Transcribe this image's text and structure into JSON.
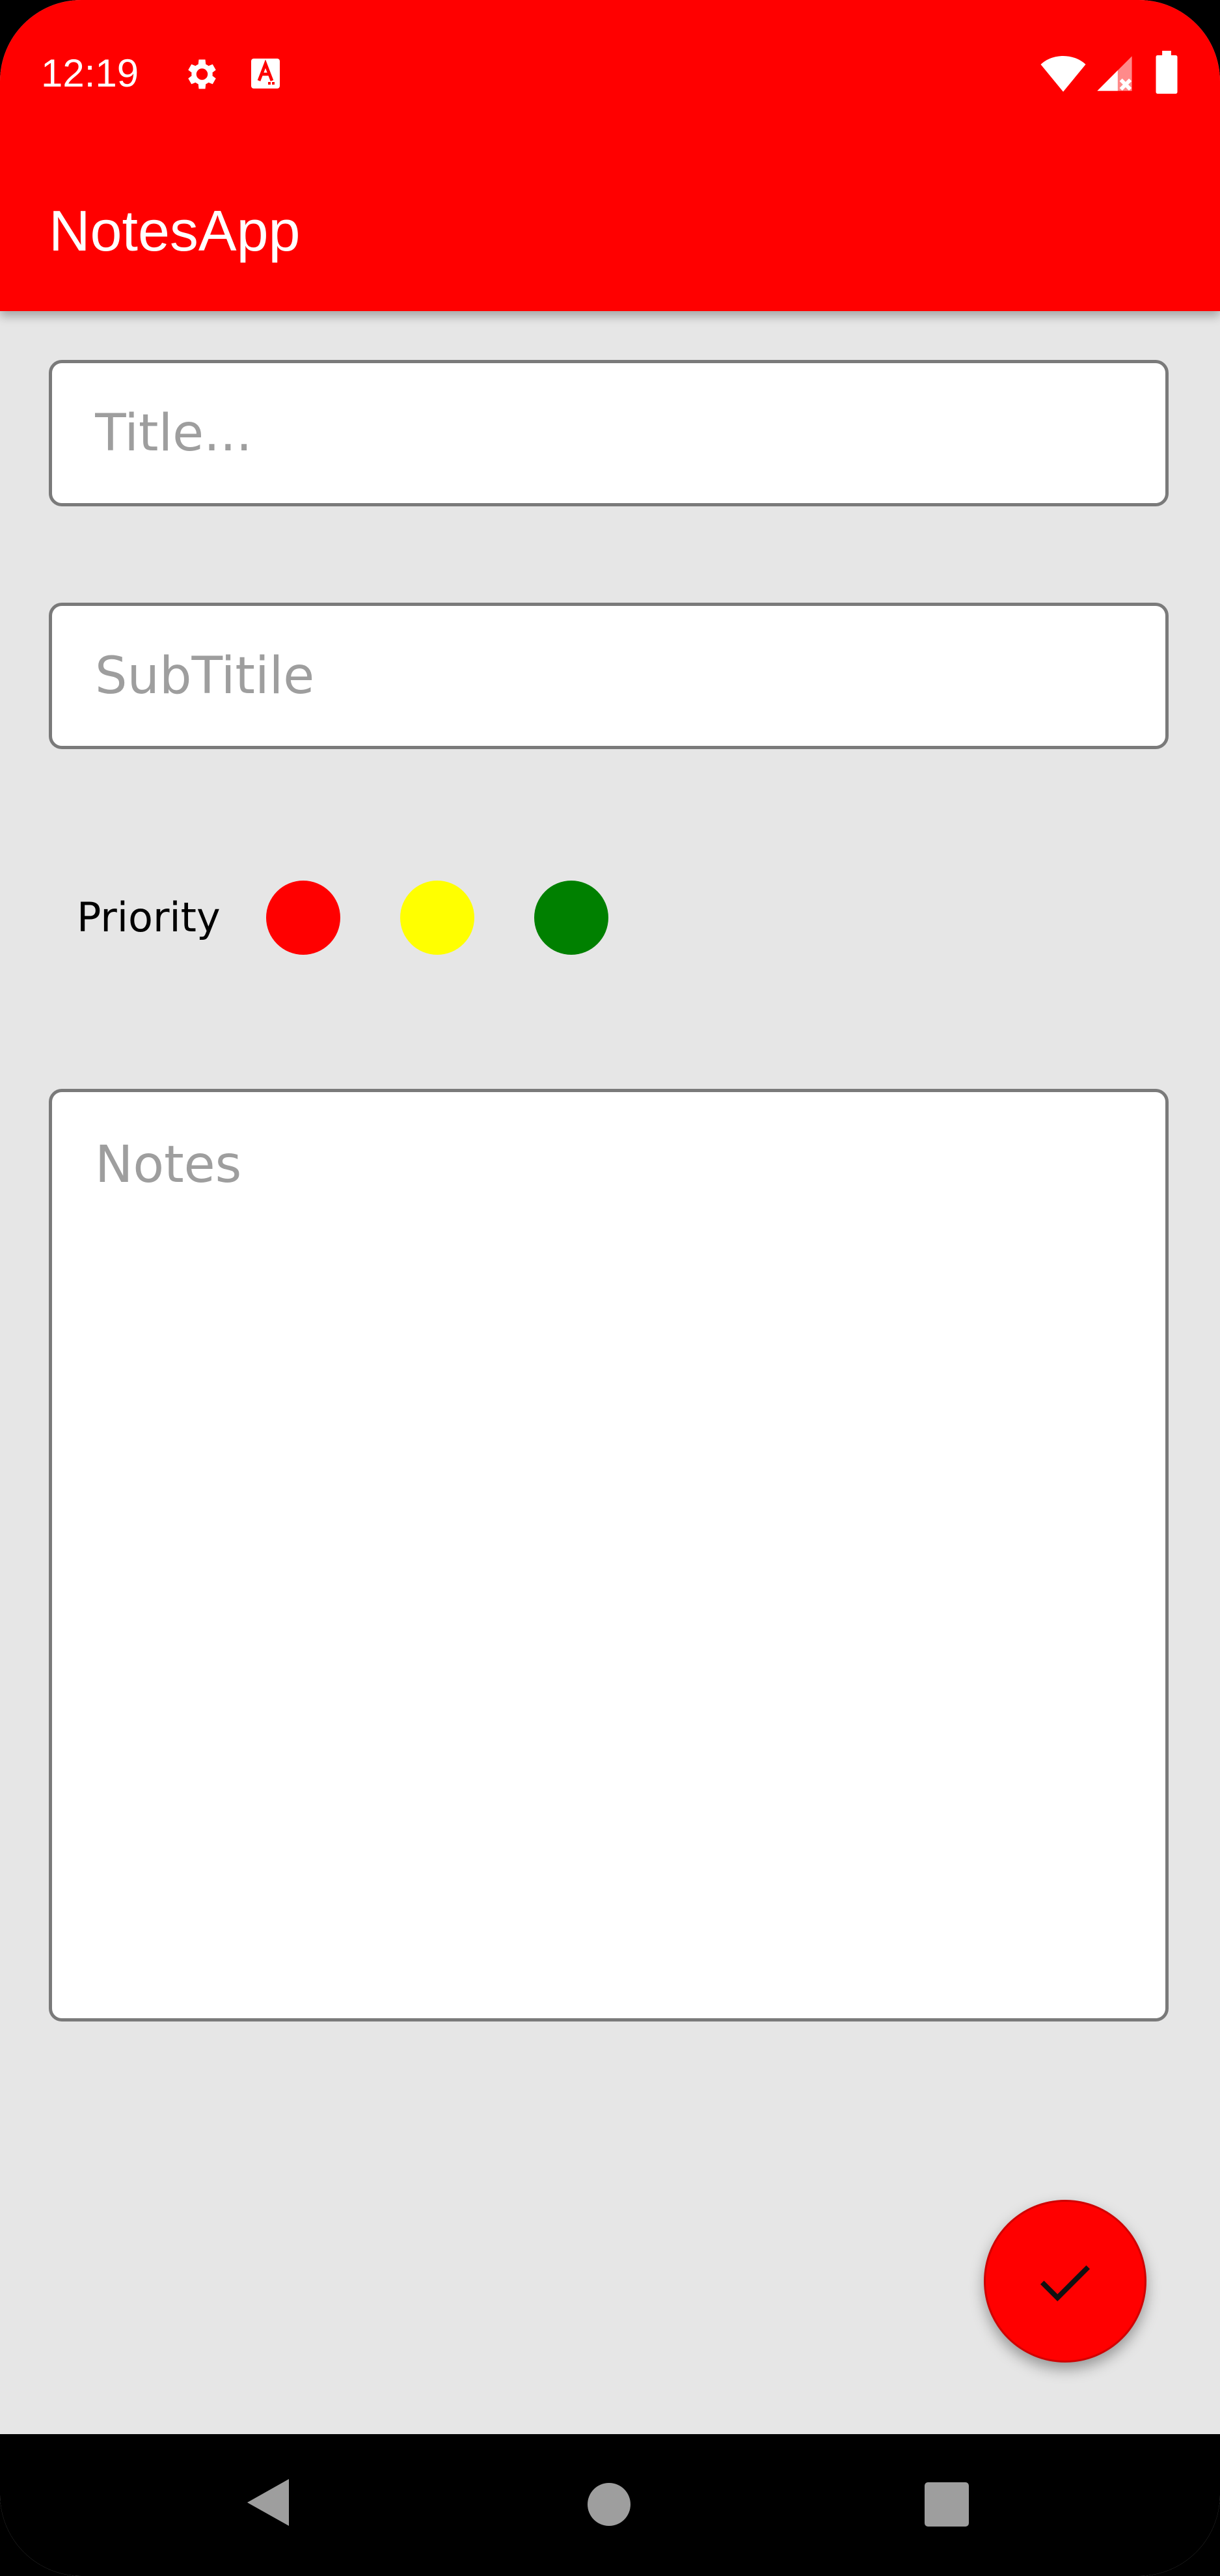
{
  "status_bar": {
    "time": "12:19",
    "icons": [
      "gear-icon",
      "text-a-icon",
      "wifi-icon",
      "signal-icon",
      "battery-icon"
    ]
  },
  "app_bar": {
    "title": "NotesApp",
    "color": "#ff0000"
  },
  "form": {
    "title_placeholder": "Title...",
    "subtitle_placeholder": "SubTitile",
    "notes_placeholder": "Notes",
    "priority_label": "Priority",
    "priority_colors": [
      "#ff0000",
      "#ffff00",
      "#008000"
    ]
  },
  "fab": {
    "icon": "check-icon",
    "color": "#ff0000"
  },
  "nav_bar": {
    "icons": [
      "back-icon",
      "home-icon",
      "recents-icon"
    ]
  }
}
